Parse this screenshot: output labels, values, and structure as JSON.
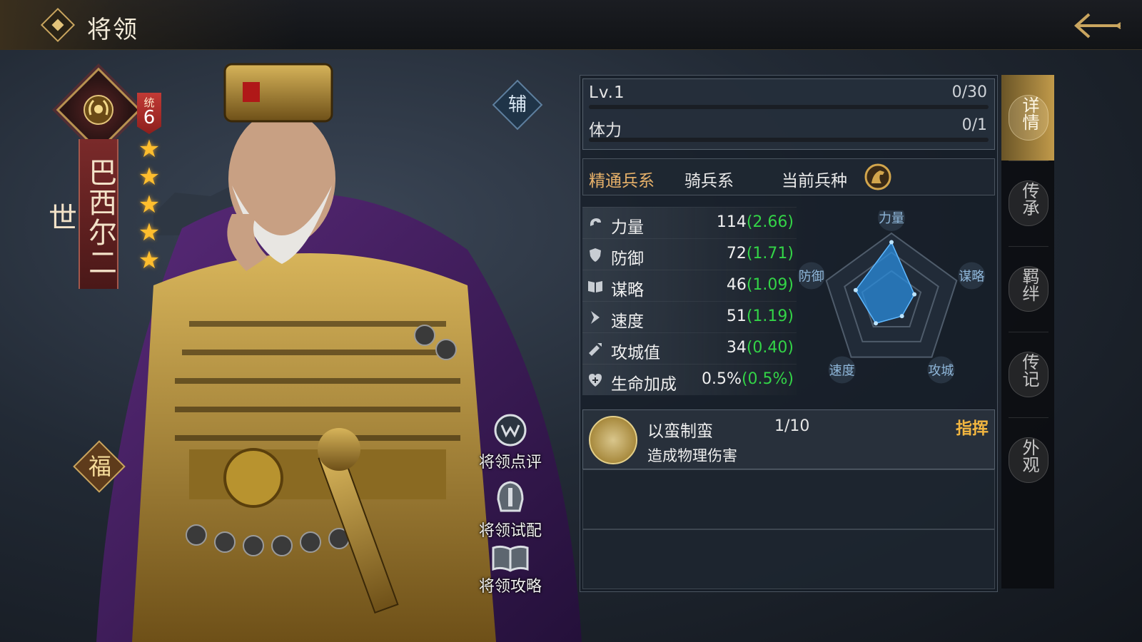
{
  "header": {
    "title": "将领"
  },
  "hero": {
    "name": "巴西尔二世",
    "tong_label": "统",
    "tong_value": "6",
    "stars": 5,
    "fu_badge": "福",
    "role_badge": "辅"
  },
  "side_actions": [
    {
      "label": "将领点评",
      "icon": "review-icon"
    },
    {
      "label": "将领试配",
      "icon": "helmet-icon"
    },
    {
      "label": "将领攻略",
      "icon": "book-icon"
    }
  ],
  "level": {
    "label": "Lv.1",
    "value": "0/30",
    "progress": 0
  },
  "stamina": {
    "label": "体力",
    "value": "0/1",
    "progress": 0
  },
  "troop": {
    "label": "精通兵系",
    "value": "骑兵系",
    "current_label": "当前兵种",
    "current_icon": "cavalry-horse-icon"
  },
  "stats": [
    {
      "icon": "strength-icon",
      "label": "力量",
      "value": "114",
      "bonus": "(2.66)"
    },
    {
      "icon": "shield-icon",
      "label": "防御",
      "value": "72",
      "bonus": "(1.71)"
    },
    {
      "icon": "book-icon",
      "label": "谋略",
      "value": "46",
      "bonus": "(1.09)"
    },
    {
      "icon": "speed-icon",
      "label": "速度",
      "value": "51",
      "bonus": "(1.19)"
    },
    {
      "icon": "siege-icon",
      "label": "攻城值",
      "value": "34",
      "bonus": "(0.40)"
    },
    {
      "icon": "health-icon",
      "label": "生命加成",
      "value": "0.5%",
      "bonus": "(0.5%)"
    }
  ],
  "radar": {
    "labels": [
      "力量",
      "谋略",
      "攻城",
      "速度",
      "防御"
    ],
    "values": [
      114,
      46,
      34,
      51,
      72
    ]
  },
  "skill": {
    "name": "以蛮制蛮",
    "level": "1/10",
    "type": "指挥",
    "description": "造成物理伤害",
    "icon": "barbarian-head-icon"
  },
  "tabs": [
    {
      "label": "详情",
      "active": true
    },
    {
      "label": "传承",
      "active": false
    },
    {
      "label": "羁绊",
      "active": false
    },
    {
      "label": "传记",
      "active": false
    },
    {
      "label": "外观",
      "active": false
    }
  ],
  "colors": {
    "accent": "#c19a4a",
    "bonus_green": "#33d447",
    "skill_type": "#f2b640",
    "star": "#ffbe2e"
  }
}
